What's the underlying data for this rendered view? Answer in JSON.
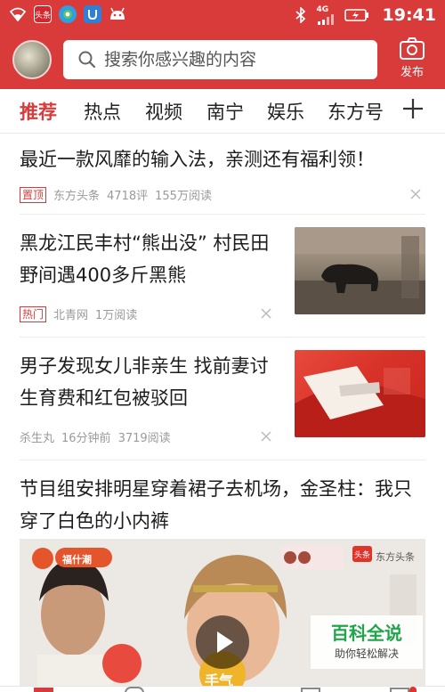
{
  "status_bar": {
    "app_badge_toutiao": "头条",
    "signal_label": "4G",
    "time": "19:41"
  },
  "header": {
    "search_placeholder": "搜索你感兴趣的内容",
    "publish_label": "发布"
  },
  "channels": {
    "tabs": [
      "推荐",
      "热点",
      "视频",
      "南宁",
      "娱乐",
      "东方号"
    ],
    "active_index": 0
  },
  "feed": [
    {
      "title": "最近一款风靡的输入法，亲测还有福利领！",
      "tag": "置顶",
      "source": "东方头条",
      "comments": "4718评",
      "reads": "155万阅读"
    },
    {
      "title": "黑龙江民丰村“熊出没” 村民田野间遇400多斤黑熊",
      "tag": "热门",
      "source": "北青网",
      "reads": "1万阅读"
    },
    {
      "title": "男子发现女儿非亲生 找前妻讨生育费和红包被驳回",
      "source": "杀生丸",
      "time": "16分钟前",
      "reads": "3719阅读"
    },
    {
      "title": "节目组安排明星穿着裙子去机场，金圣柱：我只穿了白色的小内裤",
      "video_overlay": {
        "show_logo": "福什潮",
        "channel_logo": "头条",
        "channel_name": "东方头条",
        "sticker": "手气"
      }
    }
  ],
  "watermark": {
    "main": "百科全说",
    "sub": "助你轻松解决"
  },
  "colors": {
    "brand_red": "#d93b3b",
    "tag_red": "#d93b3b",
    "meta_gray": "#9a9a9a",
    "watermark_green": "#1fa64a"
  },
  "icons": [
    "wifi-icon",
    "toutiao-app-icon",
    "browser-app-icon",
    "shield-app-icon",
    "android-icon",
    "bluetooth-icon",
    "signal-icon",
    "battery-charging-icon",
    "search-icon",
    "camera-icon",
    "plus-icon",
    "close-icon",
    "play-icon"
  ]
}
